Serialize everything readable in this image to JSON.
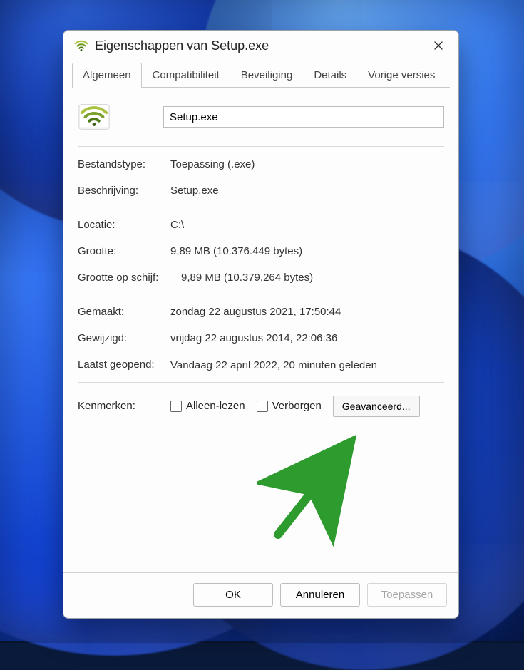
{
  "window": {
    "title": "Eigenschappen van Setup.exe",
    "icon_name": "wifi-app-icon"
  },
  "tabs": [
    {
      "label": "Algemeen",
      "active": true
    },
    {
      "label": "Compatibiliteit",
      "active": false
    },
    {
      "label": "Beveiliging",
      "active": false
    },
    {
      "label": "Details",
      "active": false
    },
    {
      "label": "Vorige versies",
      "active": false
    }
  ],
  "filename": {
    "value": "Setup.exe"
  },
  "rows": {
    "type": {
      "label": "Bestandstype:",
      "value": "Toepassing (.exe)"
    },
    "desc": {
      "label": "Beschrijving:",
      "value": "Setup.exe"
    },
    "location": {
      "label": "Locatie:",
      "value": "C:\\"
    },
    "size": {
      "label": "Grootte:",
      "value": "9,89 MB (10.376.449 bytes)"
    },
    "sizeOnDisk": {
      "label": "Grootte op schijf:",
      "value": "9,89 MB (10.379.264 bytes)"
    },
    "created": {
      "label": "Gemaakt:",
      "value": "zondag 22 augustus 2021, 17:50:44"
    },
    "modified": {
      "label": "Gewijzigd:",
      "value": "vrijdag 22 augustus 2014, 22:06:36"
    },
    "accessed": {
      "label": "Laatst geopend:",
      "value": "Vandaag 22 april 2022, 20 minuten geleden"
    }
  },
  "attributes": {
    "label": "Kenmerken:",
    "readonly_label": "Alleen-lezen",
    "readonly_checked": false,
    "hidden_label": "Verborgen",
    "hidden_checked": false,
    "advanced_label": "Geavanceerd..."
  },
  "footer": {
    "ok": "OK",
    "cancel": "Annuleren",
    "apply": "Toepassen"
  },
  "colors": {
    "arrow": "#2e9b2e"
  }
}
